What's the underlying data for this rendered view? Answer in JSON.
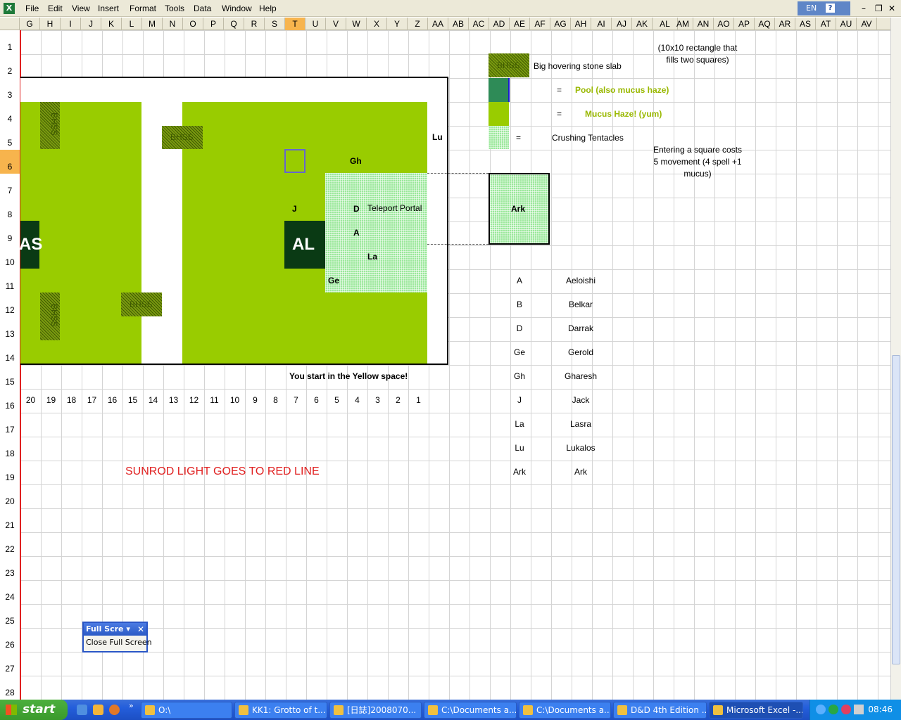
{
  "menu": [
    "File",
    "Edit",
    "View",
    "Insert",
    "Format",
    "Tools",
    "Data",
    "Window",
    "Help"
  ],
  "lang": "EN",
  "help_glyph": "?",
  "columns": [
    "G",
    "H",
    "I",
    "J",
    "K",
    "L",
    "M",
    "N",
    "O",
    "P",
    "Q",
    "R",
    "S",
    "T",
    "U",
    "V",
    "W",
    "X",
    "Y",
    "Z",
    "AA",
    "AB",
    "AC",
    "AD",
    "AE",
    "AF",
    "AG",
    "AH",
    "AI",
    "AJ",
    "AK",
    "AL",
    "AM",
    "AN",
    "AO",
    "AP",
    "AQ",
    "AR",
    "AS",
    "AT",
    "AU",
    "AV"
  ],
  "selected_column": "T",
  "rows": [
    "1",
    "2",
    "3",
    "4",
    "5",
    "6",
    "7",
    "8",
    "9",
    "10",
    "11",
    "12",
    "13",
    "14",
    "15",
    "16",
    "17",
    "18",
    "19",
    "20",
    "21",
    "22",
    "23",
    "24",
    "25",
    "26",
    "27",
    "28"
  ],
  "selected_row": "6",
  "map": {
    "bhss": "BHSS",
    "lu": "Lu",
    "gh": "Gh",
    "j": "J",
    "d": "D",
    "teleport": "Teleport Portal",
    "a": "A",
    "al": "AL",
    "as": "AS",
    "la": "La",
    "ge": "Ge",
    "start_note": "You start in the Yellow space!",
    "numbers": [
      "20",
      "19",
      "18",
      "17",
      "16",
      "15",
      "14",
      "13",
      "12",
      "11",
      "10",
      "9",
      "8",
      "7",
      "6",
      "5",
      "4",
      "3",
      "2",
      "1"
    ],
    "sunrod": "SUNROD LIGHT GOES TO RED LINE",
    "ark": "Ark"
  },
  "legend": {
    "bhss_swatch": "BHSS",
    "bhss_desc": "Big hovering stone slab",
    "rect_note": "(10x10 rectangle that fills two squares)",
    "eq": "=",
    "pool": "Pool (also mucus haze)",
    "mucus": "Mucus Haze! (yum)",
    "crushing": "Crushing Tentacles",
    "entering": "Entering a square costs 5 movement (4 spell +1 mucus)"
  },
  "roster": [
    {
      "code": "A",
      "name": "Aeloishi"
    },
    {
      "code": "B",
      "name": "Belkar"
    },
    {
      "code": "D",
      "name": "Darrak"
    },
    {
      "code": "Ge",
      "name": "Gerold"
    },
    {
      "code": "Gh",
      "name": "Gharesh"
    },
    {
      "code": "J",
      "name": "Jack"
    },
    {
      "code": "La",
      "name": "Lasra"
    },
    {
      "code": "Lu",
      "name": "Lukalos"
    },
    {
      "code": "Ark",
      "name": "Ark"
    }
  ],
  "fullscreen": {
    "title": "Full Scre",
    "close_label": "Close Full Screen"
  },
  "taskbar": {
    "start": "start",
    "more": "»",
    "buttons": [
      "O:\\",
      "KK1: Grotto of t...",
      "[日誌]2008070...",
      "C:\\Documents a...",
      "C:\\Documents a...",
      "D&D 4th Edition ...",
      "Microsoft Excel -..."
    ],
    "time": "08:46"
  },
  "colors": {
    "mucus": "#99cc00",
    "tentacle": "#9be89b",
    "dark": "#0a3a14",
    "pool": "#2e8b57",
    "red": "#e02020"
  }
}
